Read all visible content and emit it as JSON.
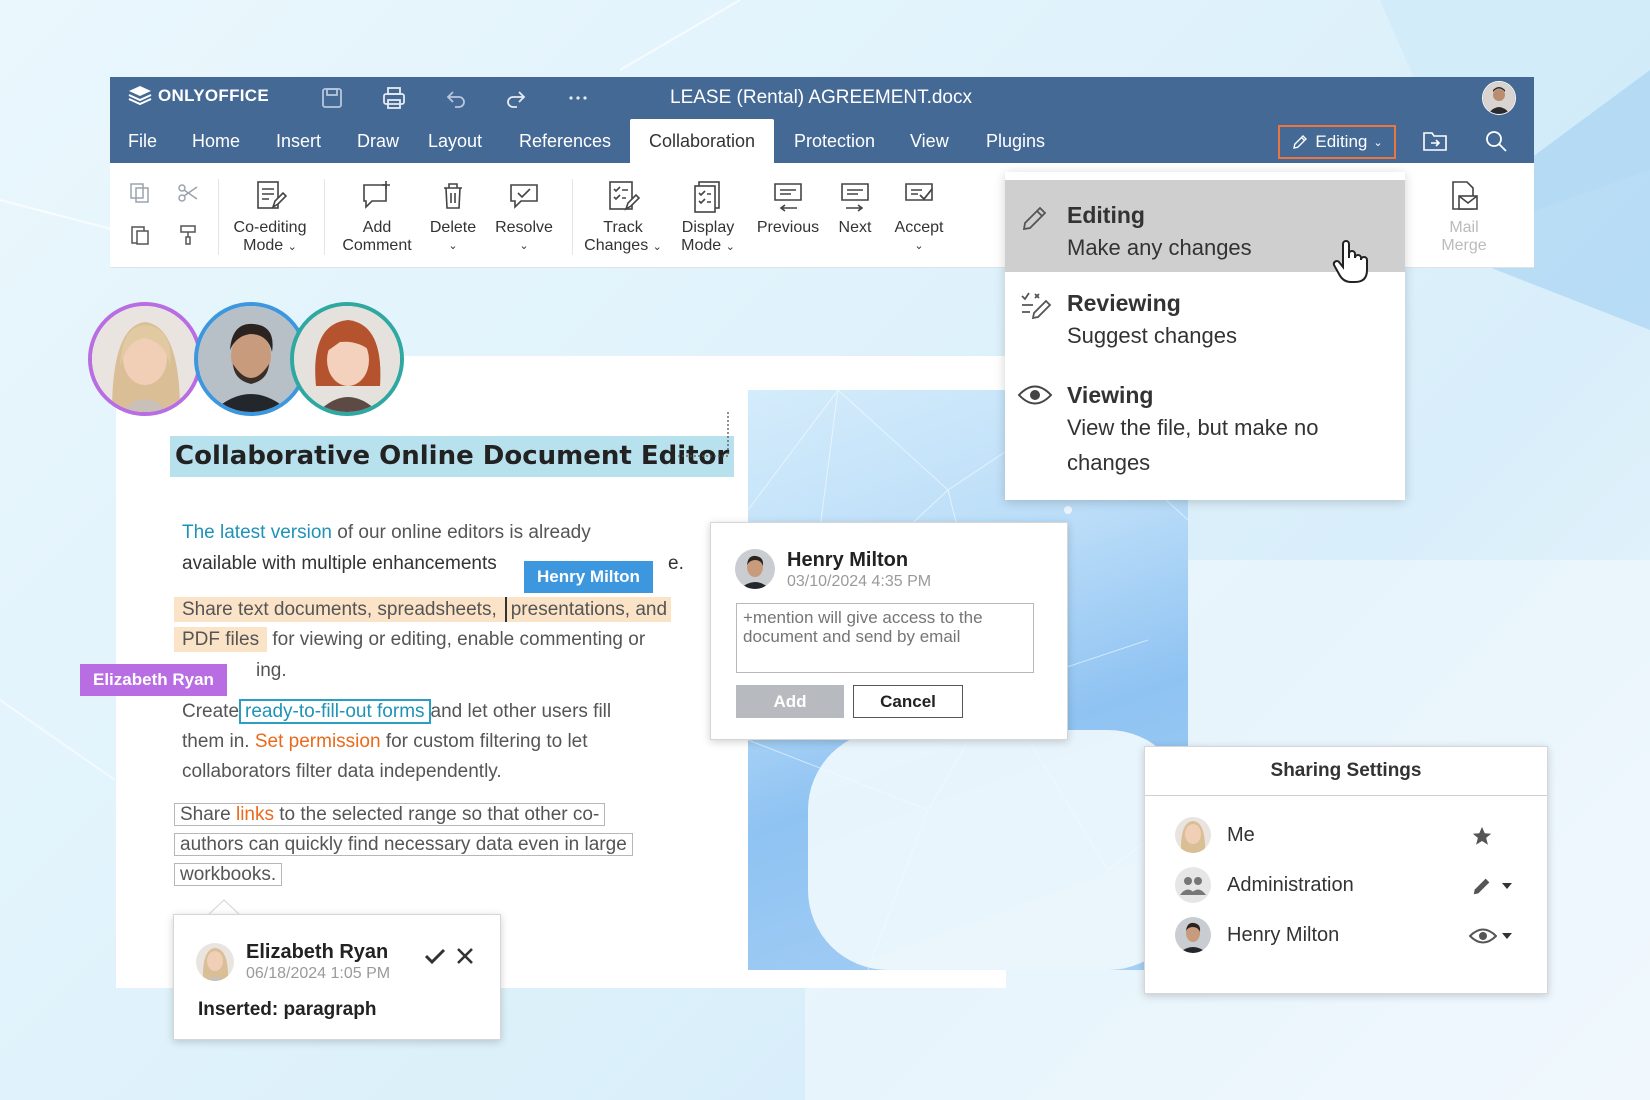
{
  "app": {
    "name": "ONLYOFFICE",
    "doc_title": "LEASE (Rental) AGREEMENT.docx"
  },
  "menu": {
    "items": [
      "File",
      "Home",
      "Insert",
      "Draw",
      "Layout",
      "References",
      "Collaboration",
      "Protection",
      "View",
      "Plugins"
    ],
    "active": "Collaboration",
    "mode_button": "Editing"
  },
  "toolbar": {
    "coediting": [
      "Co-editing",
      "Mode"
    ],
    "add_comment": [
      "Add",
      "Comment"
    ],
    "delete": "Delete",
    "resolve": "Resolve",
    "track_changes": [
      "Track",
      "Changes"
    ],
    "display_mode": [
      "Display",
      "Mode"
    ],
    "previous": "Previous",
    "next": "Next",
    "accept": "Accept",
    "mail_merge": [
      "Mail",
      "Merge"
    ]
  },
  "mode_menu": [
    {
      "title": "Editing",
      "subtitle": "Make any changes",
      "icon": "pencil-icon",
      "selected": true
    },
    {
      "title": "Reviewing",
      "subtitle": "Suggest changes",
      "icon": "review-pen-icon",
      "selected": false
    },
    {
      "title": "Viewing",
      "subtitle": "View the file, but make no changes",
      "icon": "eye-icon",
      "selected": false
    }
  ],
  "document": {
    "heading": "Collaborative Online Document Editor",
    "p1_link": "The latest version",
    "p1_rest_a": " of our online editors is already",
    "p1_line2": "available with multiple enhancements",
    "p1_tail": "e.",
    "p2_line1_a": "Share text documents, spreadsheets,",
    "p2_line1_b": "presentations, and",
    "p2_line2_a": "PDF files",
    "p2_line2_b": " for viewing  or editing, enable commenting or",
    "p2_line3": "ing.",
    "p3_a": "Create",
    "p3_link": "ready-to-fill-out forms",
    "p3_b": "and let other users fill",
    "p3_line2_a": "them in. ",
    "p3_line2_link": "Set permission",
    "p3_line2_b": " for custom filtering to let",
    "p3_line3": "collaborators filter data independently.",
    "p4_line1_a": "Share ",
    "p4_line1_link": "links",
    "p4_line1_b": " to the selected range so that other co-",
    "p4_line2": "authors can quickly find necessary data even in large",
    "p4_line3": "workbooks."
  },
  "cursors": {
    "henry": {
      "name": "Henry Milton",
      "color": "#3d97df"
    },
    "elizabeth": {
      "name": "Elizabeth Ryan",
      "color": "#b86de2"
    }
  },
  "comment": {
    "author": "Henry Milton",
    "date": "03/10/2024  4:35 PM",
    "placeholder": "+mention will give access to the document and send by email",
    "add": "Add",
    "cancel": "Cancel"
  },
  "change": {
    "author": "Elizabeth Ryan",
    "date": "06/18/2024 1:05 PM",
    "text": "Inserted: paragraph"
  },
  "sharing": {
    "title": "Sharing Settings",
    "rows": [
      {
        "name": "Me",
        "icon": "star-icon"
      },
      {
        "name": "Administration",
        "icon": "pencil-icon"
      },
      {
        "name": "Henry Milton",
        "icon": "eye-icon"
      }
    ]
  },
  "colors": {
    "header": "#446995",
    "accent_orange": "#e9763f",
    "link_blue": "#1f93b7",
    "highlight": "#fbe3c8"
  }
}
